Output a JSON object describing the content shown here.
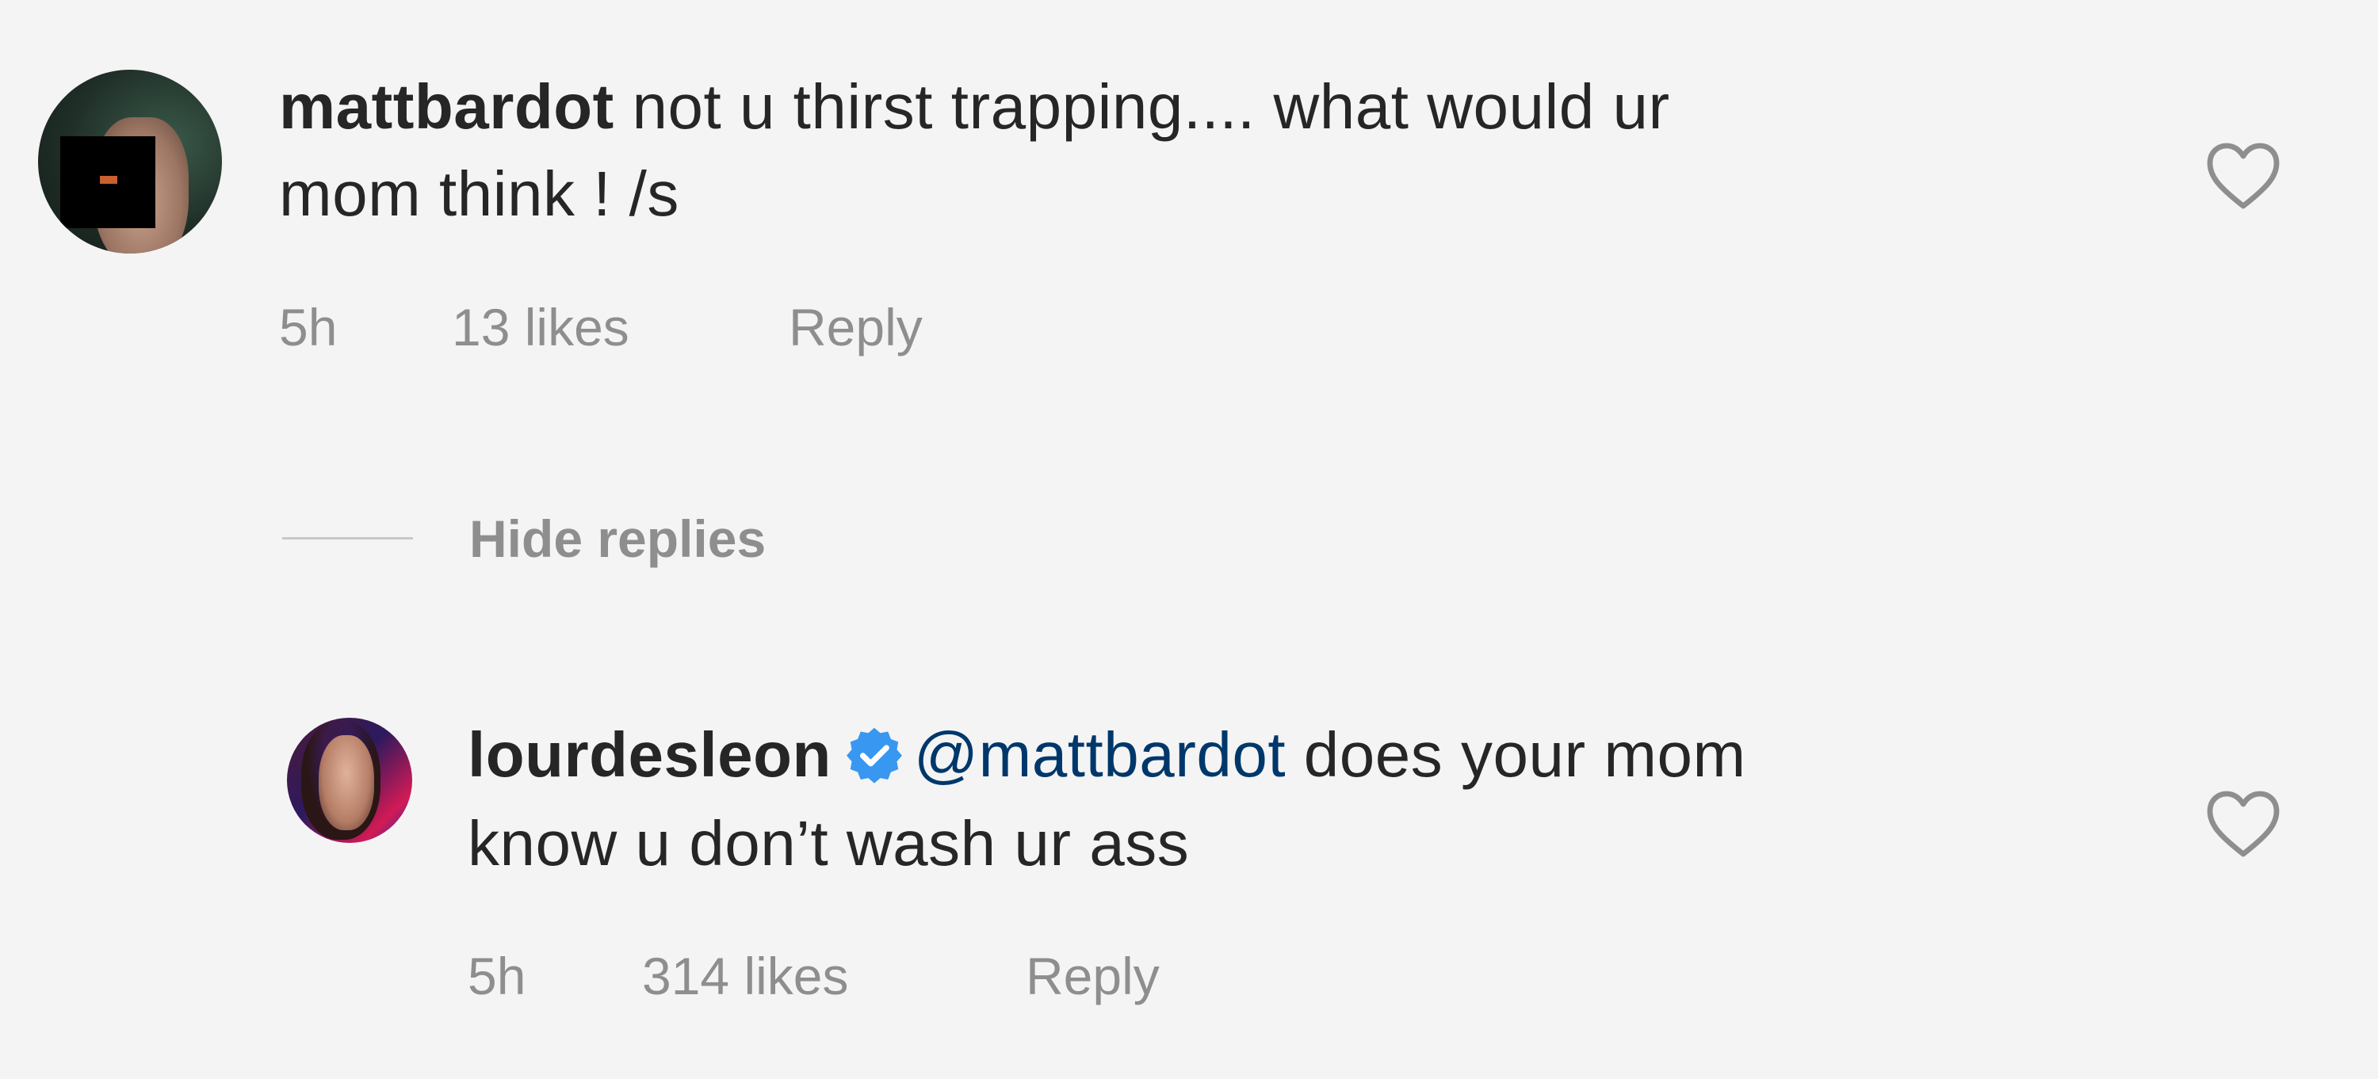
{
  "comments": [
    {
      "username": "mattbardot",
      "text_line1": "not u thirst trapping.... what would ur",
      "text_line2": "mom think ! /s",
      "time": "5h",
      "likes": "13 likes",
      "reply_label": "Reply",
      "avatar_icon": "user-avatar",
      "like_icon": "heart-outline-icon"
    },
    {
      "username": "lourdesleon",
      "verified_icon": "verified-badge-icon",
      "mention": "@mattbardot",
      "text_line1": "does your mom",
      "text_line2": "know u don’t wash ur ass",
      "time": "5h",
      "likes": "314 likes",
      "reply_label": "Reply",
      "avatar_icon": "user-avatar",
      "like_icon": "heart-outline-icon"
    }
  ],
  "replies_toggle": {
    "label": "Hide replies"
  },
  "colors": {
    "background": "#f4f4f4",
    "text": "#262626",
    "meta": "#8e8e8e",
    "mention": "#00376b",
    "verified": "#3897f0"
  }
}
